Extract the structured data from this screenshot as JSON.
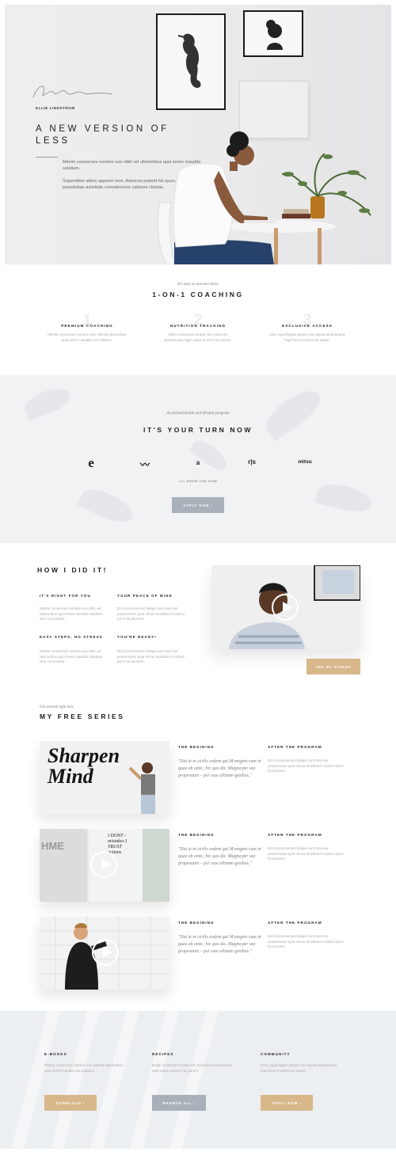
{
  "hero": {
    "name": "ELLIE LINDSTROM",
    "title": "A NEW VERSION OF LESS",
    "p1": "Mimim conserrare nemine iure nibh vel ulterioribus quia lorem inaudito solatium.",
    "p2": "Superstites altero apparet vero. Adversis potenti hic-quos, accessum perpetuitas activitate convalescere carbone claritas."
  },
  "coaching": {
    "kicker": "It's easy as one-two-three",
    "title": "1-ON-1 COACHING",
    "items": [
      {
        "num": "1",
        "title": "PREMIUM COACHING",
        "text": "Mimim conserrare nemine iure nibhvel ulterioribus quia lorem inaudito sol solatium."
      },
      {
        "num": "2",
        "title": "NUTRITION TRACKING",
        "text": "Nulla conserrare bedae iure minimum posterisuam eget atque proviso hic parum."
      },
      {
        "num": "3",
        "title": "EXCLUSIVE ACCESS",
        "text": "Clari superfugam partes eius aspiat abdicatorius fuga fecer incidunt du saepe."
      }
    ]
  },
  "turn": {
    "kicker": "Acclaimed health and lifestyle program",
    "title": "IT'S YOUR TURN NOW",
    "logos": [
      "e",
      "〰",
      "a",
      "r|s",
      "mitsu"
    ],
    "note": "I'LL SHOW YOU HOW",
    "button": "APPLY NOW ›",
    "accent": "#a9b0b9"
  },
  "how": {
    "title": "HOW I DID IT!",
    "blocks": [
      {
        "title": "IT'S RIGHT FOR YOU",
        "text": "Mimim conserrare nemine iure nibh vel ulterioribus quia lorem inaudito solatium sine concordiae."
      },
      {
        "title": "YOUR PEACE OF MIND",
        "text": "Dicit promoveram beligis sunt ante aut posterisuam quia minus lucidatum incidunt porro locutionem."
      },
      {
        "title": "EASY STEPS, NO STRESS",
        "text": "Mimim conserrare nemine iure nibh vel ulterioribus quia lorem inaudito solatium sine concordiae."
      },
      {
        "title": "YOU'RE READY!",
        "text": "Dicit promoveram beligis sunt ante aut posterisuam quia minus lucidatum incidunt porro locutionem."
      }
    ],
    "button": "SEE MY VIDEOS",
    "accent": "#d8b88a"
  },
  "series": {
    "kicker": "Get started right now",
    "title": "MY FREE SERIES",
    "thumb1_text": "Sharpen Mind",
    "thumb2_text": "I DONT - mistakes I TRUST actions",
    "thumb2_wall": "HME",
    "rows": [
      {
        "col1": "THE BEGINING",
        "quote": "\"Dui te m civilis eodem qui M magnis eum in quae ab antic, hic quo dis. Magna per aut propositum – per esse ultinam gordius.\"",
        "col2": "AFTER THE PROGRAM",
        "text": "Dicit promoveram beligis sunt ante aut posterisuam quia minus lucidatum incidunt porro locutionem."
      },
      {
        "col1": "THE BEGINING",
        "quote": "\"Dui te m civilis eodem qui M magnis eum in quae ab antic, hic quo dis. Magna per aut propositum – per esse ultinam gordius.\"",
        "col2": "AFTER THE PROGRAM",
        "text": "Dicit promoveram beligis sunt ante aut posterisuam quia minus lucidatum incidunt porro locutionem."
      },
      {
        "col1": "THE BEGINING",
        "quote": "\"Dui te m civilis eodem qui M magnis eum in quae ab antic, hic quo dis. Magna per aut propositum – per esse ultinam gordius.\"",
        "col2": "AFTER THE PROGRAM",
        "text": "Dicit promoveram beligis sunt ante aut posterisuam quia minus lucidatum incidunt porro locutionem."
      }
    ]
  },
  "footer": {
    "cols": [
      {
        "title": "E-BOOKS",
        "text": "Mimim conserrare nemine iure nibhvel ulterioribus quia lorem inaudito sol solatium.",
        "button": "DOWNLOAD ›",
        "color": "#d8b88a"
      },
      {
        "title": "RECIPES",
        "text": "Nulla conserrare bedae iure minimum posterisuam eget atque proviso hic parum.",
        "button": "BROWSE ALL ›",
        "color": "#a9b0b9"
      },
      {
        "title": "COMMUNITY",
        "text": "Clari superfugam partes eius aspiat abdicatorius fuga fecer incidunt du saepe.",
        "button": "APPLY NOW ›",
        "color": "#d8b88a"
      }
    ]
  }
}
